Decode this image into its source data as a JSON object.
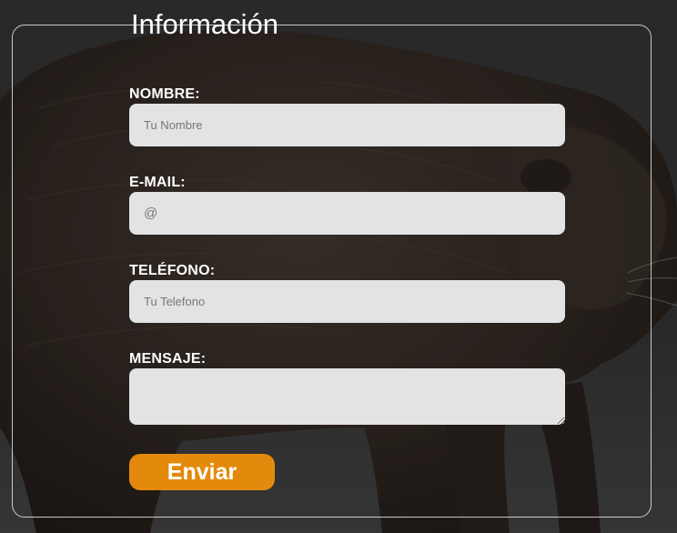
{
  "form": {
    "legend": "Información",
    "fields": [
      {
        "label": "NOMBRE:",
        "placeholder": "Tu Nombre",
        "value": ""
      },
      {
        "label": "E-MAIL:",
        "placeholder": "@",
        "value": ""
      },
      {
        "label": "TELÉFONO:",
        "placeholder": "Tu Telefono",
        "value": ""
      },
      {
        "label": "MENSAJE:",
        "placeholder": "",
        "value": ""
      }
    ],
    "submit_label": "Enviar"
  },
  "colors": {
    "button": "#e38a0c",
    "input_bg": "#e3e3e3",
    "label": "#ffffff"
  },
  "background": {
    "icon": "capybara-photo"
  }
}
